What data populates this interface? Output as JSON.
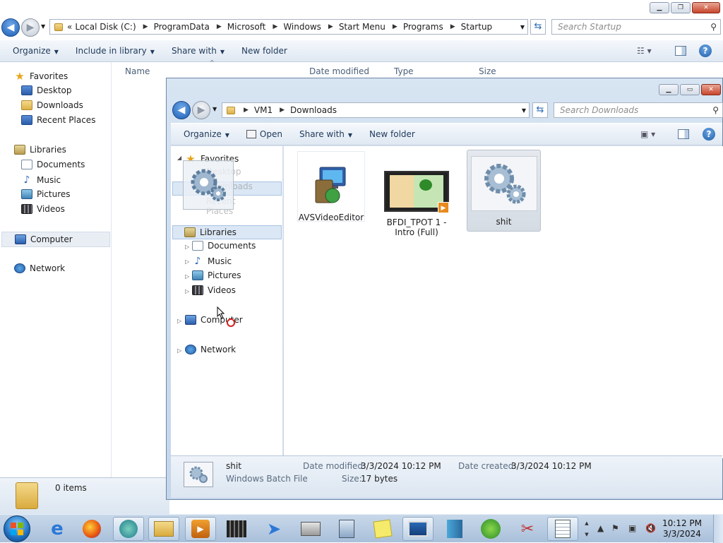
{
  "back_window": {
    "breadcrumb": [
      "Local Disk (C:)",
      "ProgramData",
      "Microsoft",
      "Windows",
      "Start Menu",
      "Programs",
      "Startup"
    ],
    "overflow_label": "«",
    "search_placeholder": "Search Startup",
    "toolbar": {
      "organize": "Organize",
      "include": "Include in library",
      "share": "Share with",
      "new_folder": "New folder"
    },
    "nav": {
      "favorites": "Favorites",
      "desktop": "Desktop",
      "downloads": "Downloads",
      "recent": "Recent Places",
      "libraries": "Libraries",
      "documents": "Documents",
      "music": "Music",
      "pictures": "Pictures",
      "videos": "Videos",
      "computer": "Computer",
      "network": "Network"
    },
    "columns": {
      "name": "Name",
      "date_modified": "Date modified",
      "type": "Type",
      "size": "Size"
    },
    "status": "0 items"
  },
  "front_window": {
    "breadcrumb": [
      "VM1",
      "Downloads"
    ],
    "search_placeholder": "Search Downloads",
    "toolbar": {
      "organize": "Organize",
      "open": "Open",
      "share": "Share with",
      "new_folder": "New folder"
    },
    "nav": {
      "favorites": "Favorites",
      "desktop": "Desktop",
      "downloads": "Downloads",
      "recent": "Recent Places",
      "libraries": "Libraries",
      "documents": "Documents",
      "music": "Music",
      "pictures": "Pictures",
      "videos": "Videos",
      "computer": "Computer",
      "network": "Network"
    },
    "files": [
      {
        "name": "AVSVideoEditor",
        "icon": "installer-icon"
      },
      {
        "name": "BFDI_TPOT 1 - Intro (Full)",
        "icon": "video-file-icon"
      },
      {
        "name": "shit",
        "icon": "batch-file-icon",
        "selected": true
      }
    ],
    "details": {
      "name": "shit",
      "type": "Windows Batch File",
      "date_modified_label": "Date modified:",
      "date_modified": "3/3/2024 10:12 PM",
      "date_created_label": "Date created:",
      "date_created": "3/3/2024 10:12 PM",
      "size_label": "Size:",
      "size": "17 bytes"
    }
  },
  "taskbar": {
    "apps": [
      "internet-explorer-icon",
      "firefox-icon",
      "app-globe-icon",
      "file-explorer-icon",
      "media-player-icon",
      "movie-maker-icon",
      "messenger-icon",
      "printer-icon",
      "calculator-icon",
      "sticky-notes-icon",
      "remote-desktop-icon",
      "archive-icon",
      "windows-update-icon",
      "snipping-tool-icon",
      "notepad-icon"
    ],
    "time": "10:12 PM",
    "date": "3/3/2024"
  }
}
